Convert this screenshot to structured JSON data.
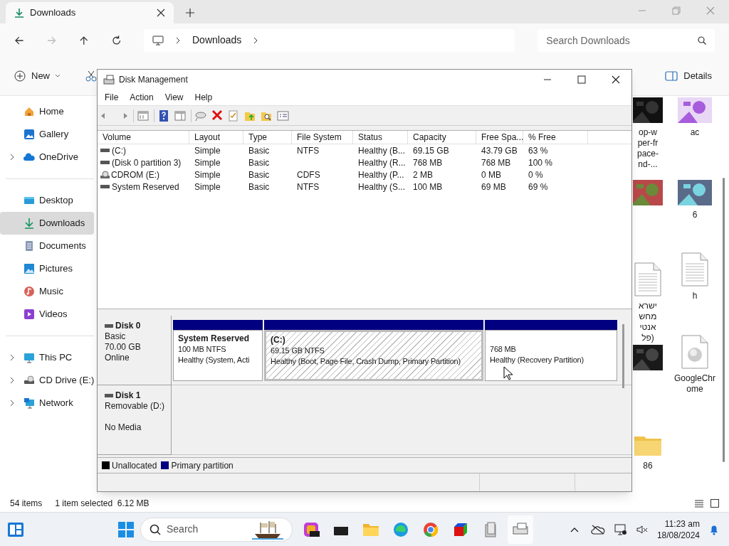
{
  "explorer": {
    "tab": {
      "title": "Downloads"
    },
    "breadcrumb": [
      "Downloads"
    ],
    "search": {
      "placeholder": "Search Downloads"
    },
    "command_bar": {
      "new": "New",
      "details": "Details"
    },
    "sidebar": {
      "groups": [
        [
          {
            "label": "Home",
            "expandable": false,
            "selected": false
          },
          {
            "label": "Gallery",
            "expandable": false,
            "selected": false
          },
          {
            "label": "OneDrive",
            "expandable": true,
            "selected": false
          }
        ],
        [
          {
            "label": "Desktop",
            "expandable": false,
            "selected": false
          },
          {
            "label": "Downloads",
            "expandable": false,
            "selected": true
          },
          {
            "label": "Documents",
            "expandable": false,
            "selected": false
          },
          {
            "label": "Pictures",
            "expandable": false,
            "selected": false
          },
          {
            "label": "Music",
            "expandable": false,
            "selected": false
          },
          {
            "label": "Videos",
            "expandable": false,
            "selected": false
          }
        ],
        [
          {
            "label": "This PC",
            "expandable": true,
            "selected": false
          },
          {
            "label": "CD Drive (E:)",
            "expandable": true,
            "selected": false
          },
          {
            "label": "Network",
            "expandable": true,
            "selected": false
          }
        ]
      ]
    },
    "files": [
      [
        {
          "kind": "picture",
          "label_lines": [
            "op-w",
            "per-fr",
            "pace-",
            "nd-..."
          ]
        },
        {
          "kind": "picture"
        },
        {
          "kind": "text",
          "label_lines": [
            "ישרא",
            "מחש",
            "אנטי",
            "(פל"
          ]
        },
        {
          "kind": "picture"
        },
        {
          "kind": "folder",
          "label_lines": [
            "86"
          ]
        }
      ],
      [
        {
          "kind": "picture",
          "label_lines": [
            "ac"
          ]
        },
        {
          "kind": "picture",
          "label_lines": [
            "6"
          ]
        },
        {
          "kind": "text",
          "label_lines": [
            "h"
          ]
        },
        {
          "kind": "installer",
          "label_lines": [
            "GoogleChr",
            "ome"
          ]
        }
      ]
    ],
    "status_bar": {
      "count": "54 items",
      "selection": "1 item selected  6.12 MB"
    }
  },
  "disk_management": {
    "title": "Disk Management",
    "menu": [
      "File",
      "Action",
      "View",
      "Help"
    ],
    "table": {
      "columns": [
        "Volume",
        "Layout",
        "Type",
        "File System",
        "Status",
        "Capacity",
        "Free Spa...",
        "% Free"
      ],
      "rows": [
        {
          "kind": "disk",
          "cells": [
            "(C:)",
            "Simple",
            "Basic",
            "NTFS",
            "Healthy (B...",
            "69.15 GB",
            "43.79 GB",
            "63 %"
          ]
        },
        {
          "kind": "disk",
          "cells": [
            "(Disk 0 partition 3)",
            "Simple",
            "Basic",
            "",
            "Healthy (R...",
            "768 MB",
            "768 MB",
            "100 %"
          ]
        },
        {
          "kind": "cdrom",
          "cells": [
            "CDROM (E:)",
            "Simple",
            "Basic",
            "CDFS",
            "Healthy (P...",
            "2 MB",
            "0 MB",
            "0 %"
          ]
        },
        {
          "kind": "disk",
          "cells": [
            "System Reserved",
            "Simple",
            "Basic",
            "NTFS",
            "Healthy (S...",
            "100 MB",
            "69 MB",
            "69 %"
          ]
        }
      ]
    },
    "disks": [
      {
        "name": "Disk 0",
        "lines": [
          "Basic",
          "70.00 GB"
        ],
        "status": "Online",
        "partitions": [
          {
            "name": "System Reserved",
            "lines": [
              "100 MB NTFS",
              "Healthy (System, Acti"
            ],
            "selected": false
          },
          {
            "name": "(C:)",
            "lines": [
              "69.15 GB NTFS",
              "Healthy (Boot, Page File, Crash Dump, Primary Partition)"
            ],
            "selected": true
          },
          {
            "lines": [
              "768 MB",
              "Healthy (Recovery Partition)"
            ],
            "selected": false
          }
        ]
      },
      {
        "name": "Disk 1",
        "lines": [
          "Removable (D:)"
        ],
        "status": "No Media"
      }
    ],
    "legend": [
      {
        "label": "Unallocated",
        "color": "#000000"
      },
      {
        "label": "Primary partition",
        "color": "#000080"
      }
    ]
  },
  "taskbar": {
    "search": "Search",
    "clock": {
      "time": "11:23 am",
      "date": "18/08/2024"
    }
  }
}
